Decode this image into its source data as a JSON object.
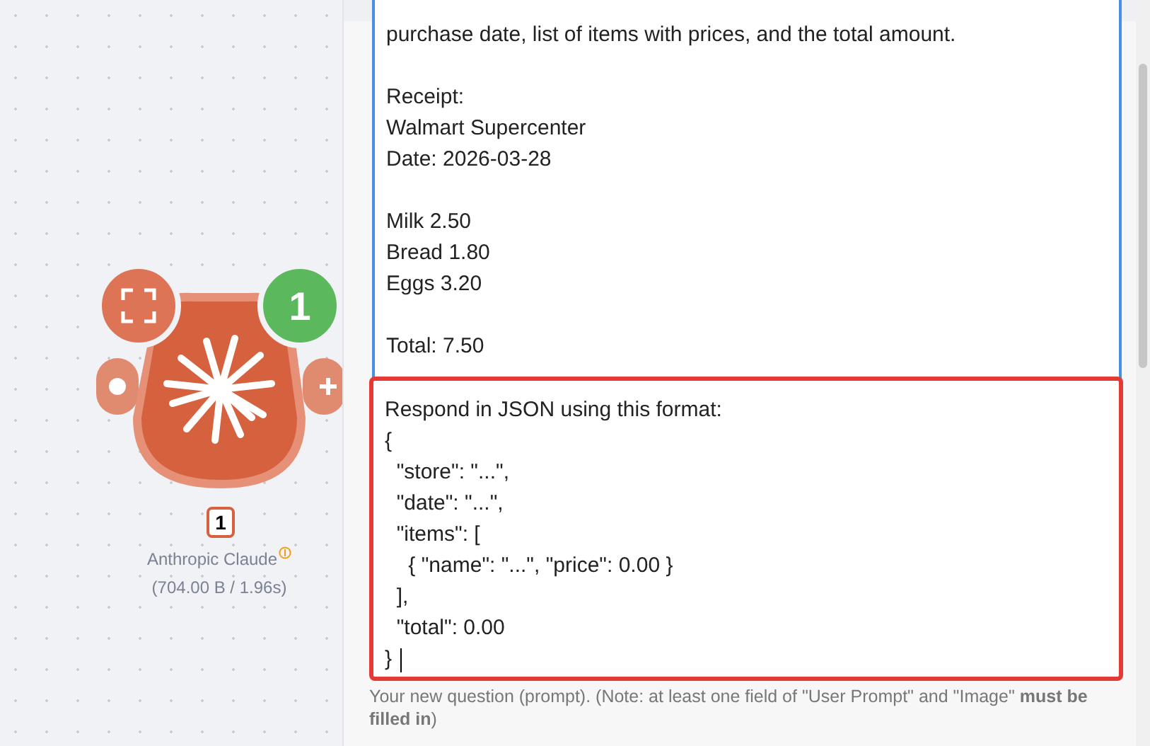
{
  "node": {
    "app": "Anthropic Claude",
    "operations": "1",
    "step": "1",
    "stats": "(704.00 B / 1.96s)"
  },
  "prompt": {
    "paragraphs": [
      [
        "purchase date, list of items with prices, and the total amount."
      ],
      [
        "Receipt:",
        "Walmart Supercenter",
        "Date: 2026-03-28"
      ],
      [
        "Milk 2.50",
        "Bread 1.80",
        "Eggs 3.20"
      ],
      [
        "Total: 7.50"
      ]
    ],
    "highlighted_lines": [
      "Respond in JSON using this format:",
      "{",
      "  \"store\": \"...\",",
      "  \"date\": \"...\",",
      "  \"items\": [",
      "    { \"name\": \"...\", \"price\": 0.00 }",
      "  ],",
      "  \"total\": 0.00",
      "}"
    ],
    "hint": "Your new question (prompt). (Note: at least one field of \"User Prompt\" and \"Image\" **must be filled in**)"
  }
}
